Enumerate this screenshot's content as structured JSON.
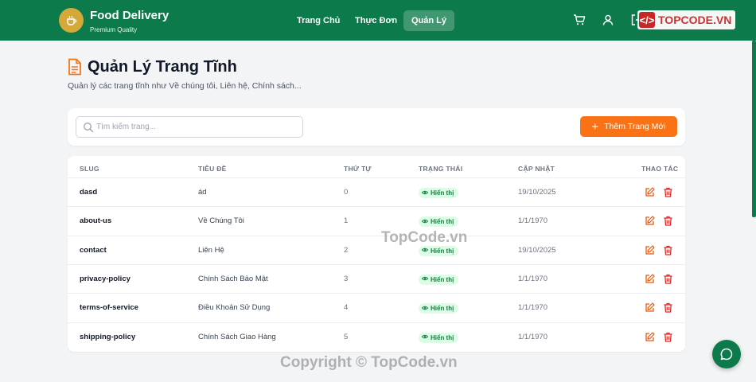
{
  "header": {
    "brand_title": "Food Delivery",
    "brand_subtitle": "Premium Quality",
    "nav": [
      {
        "label": "Trang Chủ",
        "active": false
      },
      {
        "label": "Thực Đơn",
        "active": false
      },
      {
        "label": "Quản Lý",
        "active": true
      }
    ],
    "icons": [
      "cart-icon",
      "user-icon",
      "logout-icon"
    ],
    "watermark_logo": "TOPCODE.VN"
  },
  "page": {
    "title": "Quản Lý Trang Tĩnh",
    "subtitle": "Quản lý các trang tĩnh như Về chúng tôi, Liên hệ, Chính sách..."
  },
  "search": {
    "placeholder": "Tìm kiếm trang...",
    "value": ""
  },
  "add_button": {
    "label": "Thêm Trang Mới"
  },
  "table": {
    "headers": [
      "SLUG",
      "TIÊU ĐỀ",
      "THỨ TỰ",
      "TRẠNG THÁI",
      "CẬP NHẬT",
      "THAO TÁC"
    ],
    "rows": [
      {
        "slug": "dasd",
        "title": "ád",
        "order": "0",
        "status": "Hiển thị",
        "updated": "19/10/2025"
      },
      {
        "slug": "about-us",
        "title": "Về Chúng Tôi",
        "order": "1",
        "status": "Hiển thị",
        "updated": "1/1/1970"
      },
      {
        "slug": "contact",
        "title": "Liên Hệ",
        "order": "2",
        "status": "Hiển thị",
        "updated": "19/10/2025"
      },
      {
        "slug": "privacy-policy",
        "title": "Chính Sách Bảo Mật",
        "order": "3",
        "status": "Hiển thị",
        "updated": "1/1/1970"
      },
      {
        "slug": "terms-of-service",
        "title": "Điều Khoản Sử Dụng",
        "order": "4",
        "status": "Hiển thị",
        "updated": "1/1/1970"
      },
      {
        "slug": "shipping-policy",
        "title": "Chính Sách Giao Hàng",
        "order": "5",
        "status": "Hiển thị",
        "updated": "1/1/1970"
      }
    ]
  },
  "watermark": {
    "middle": "TopCode.vn",
    "bottom": "Copyright © TopCode.vn"
  },
  "colors": {
    "header": "#0d7a4c",
    "accent": "#f97316",
    "logo": "#d4a93a",
    "badge_bg": "#dcfce7",
    "badge_text": "#15803d",
    "edit": "#ea580c",
    "delete": "#dc2626"
  }
}
